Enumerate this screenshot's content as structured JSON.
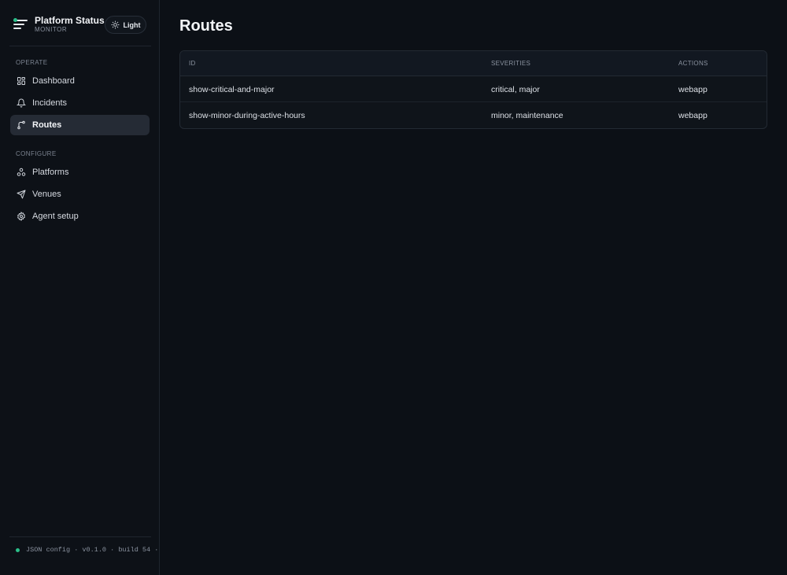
{
  "brand": {
    "title": "Platform Status",
    "subtitle": "MONITOR"
  },
  "theme_toggle": {
    "label": "Light"
  },
  "sidebar": {
    "sections": [
      {
        "label": "OPERATE"
      },
      {
        "label": "CONFIGURE"
      }
    ],
    "items": [
      {
        "label": "Dashboard",
        "icon": "grid-icon"
      },
      {
        "label": "Incidents",
        "icon": "bell-icon"
      },
      {
        "label": "Routes",
        "icon": "route-icon",
        "active": true
      },
      {
        "label": "Platforms",
        "icon": "nodes-icon"
      },
      {
        "label": "Venues",
        "icon": "send-icon"
      },
      {
        "label": "Agent setup",
        "icon": "gear-icon"
      }
    ]
  },
  "footer": {
    "text": "JSON config · v0.1.0 · build 54 ·"
  },
  "page": {
    "title": "Routes"
  },
  "table": {
    "columns": [
      "ID",
      "SEVERITIES",
      "ACTIONS"
    ],
    "rows": [
      {
        "id": "show-critical-and-major",
        "severities": "critical, major",
        "actions": "webapp"
      },
      {
        "id": "show-minor-during-active-hours",
        "severities": "minor, maintenance",
        "actions": "webapp"
      }
    ]
  },
  "colors": {
    "accent": "#2bbf8a",
    "background": "#0c1016",
    "active_nav": "#252b35"
  }
}
